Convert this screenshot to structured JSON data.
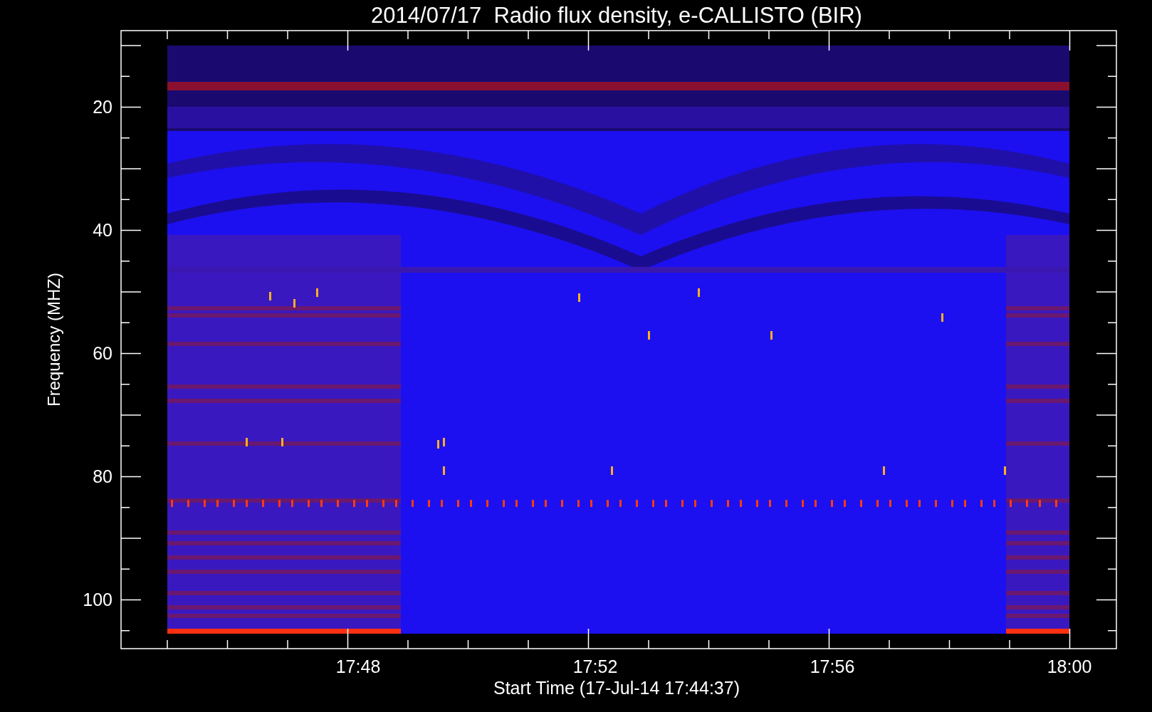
{
  "title": "2014/07/17  Radio flux density, e-CALLISTO (BIR)",
  "y_axis": {
    "label": "Frequency (MHZ)",
    "ticks": [
      "20",
      "40",
      "60",
      "80",
      "100"
    ]
  },
  "x_axis": {
    "label": "Start Time (17-Jul-14 17:44:37)",
    "ticks": [
      "17:48",
      "17:52",
      "17:56",
      "18:00"
    ]
  }
}
